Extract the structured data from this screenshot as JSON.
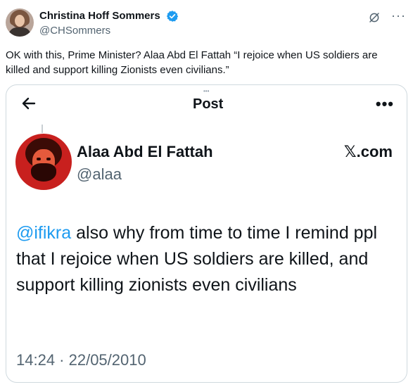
{
  "tweet": {
    "author": {
      "name": "Christina Hoff Sommers",
      "handle": "@CHSommers",
      "verified": true
    },
    "text": "OK with this, Prime Minister? Alaa Abd El Fattah “I rejoice when US soldiers are killed and support killing Zionists even civilians.”"
  },
  "embedded": {
    "header": {
      "title": "Post",
      "back_icon": "arrow-left-icon",
      "more_label": "•••"
    },
    "author": {
      "name": "Alaa Abd El Fattah",
      "handle": "@alaa"
    },
    "brand": "𝕏.com",
    "body": {
      "mention": "@ifikra",
      "text": " also why from time to time I remind ppl that I rejoice when US soldiers are killed, and support killing zionists even civilians"
    },
    "timestamp": "14:24 · 22/05/2010"
  },
  "colors": {
    "link": "#1d9bf0",
    "secondary_text": "#536471",
    "verified_badge": "#1d9bf0",
    "card_border": "#cfd9de"
  }
}
